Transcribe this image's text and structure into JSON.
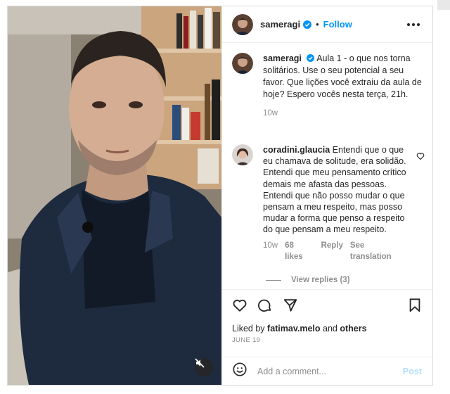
{
  "post": {
    "author": "sameragi",
    "follow_label": "Follow",
    "dot": "•",
    "caption": "Aula 1 - o que nos torna solitários. Use o seu potencial a seu favor. Que lições você extraiu da aula de hoje? Espero vocês nesta terça, 21h.",
    "caption_time": "10w",
    "liked_by_prefix": "Liked by ",
    "liked_by_user": "fatimav.melo",
    "liked_by_and": " and ",
    "liked_by_others": "others",
    "date": "JUNE 19"
  },
  "comment": {
    "user": "coradini.glaucia",
    "text": "Entendi que o que eu chamava de solitude, era solidão. Entendi que meu pensamento crítico demais me afasta das pessoas. Entendi que não posso mudar o que pensam a meu respeito, mas posso mudar a forma que penso a respeito do que pensam a meu respeito.",
    "time": "10w",
    "likes": "68 likes",
    "reply_label": "Reply",
    "translate_label": "See translation",
    "view_replies": "View replies (3)"
  },
  "composer": {
    "placeholder": "Add a comment...",
    "post_label": "Post"
  },
  "icons": [
    "heart-icon",
    "comment-icon",
    "share-icon",
    "bookmark-icon",
    "emoji-icon",
    "verified-badge-icon",
    "more-options-icon",
    "mute-icon"
  ],
  "colors": {
    "accent": "#0095f6",
    "verified": "#0095f6",
    "muted": "#8e8e8e",
    "post_disabled": "#b2dffc"
  }
}
